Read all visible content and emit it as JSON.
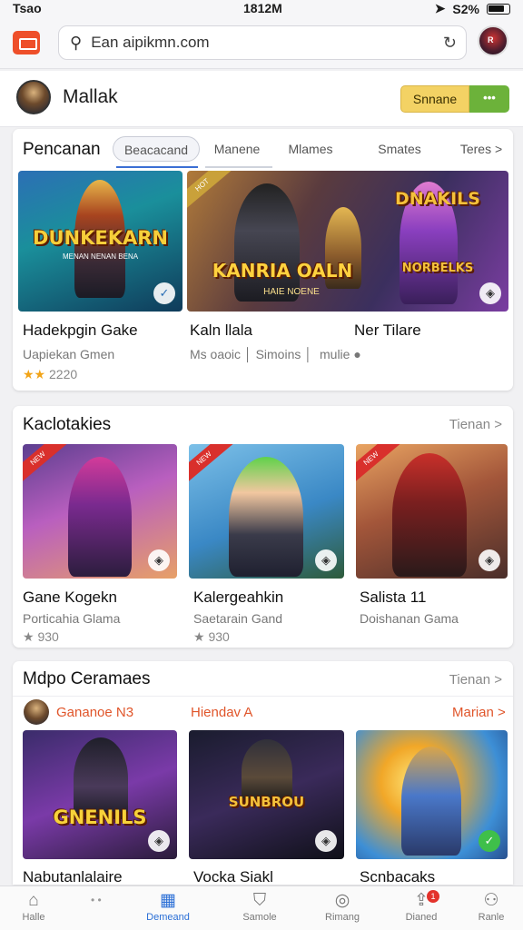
{
  "status": {
    "carrier": "Tsao",
    "time": "1812M",
    "battery": "S2%"
  },
  "browser": {
    "url": "Ean aipikmn.com",
    "avatar_text": "R"
  },
  "profile": {
    "name": "Mallak",
    "primary_button": "Snnane",
    "secondary_button": "•••"
  },
  "section1": {
    "title": "Pencanan",
    "tabs": [
      "Beacacand",
      "Manene",
      "Mlames",
      "Smates",
      "Teres >"
    ],
    "items": [
      {
        "banner": "DUNKEKARN",
        "banner_sub": "MENAN NENAN BENA",
        "title": "Hadekpgin Gake",
        "sub": "Uapiekan Gmen",
        "rating": "2220"
      },
      {
        "banner": "KANRIA OALN",
        "banner_sub": "HAIE NOENE",
        "title": "Kaln llala",
        "sub": "Ms oaoic",
        "sub2": "Simoins"
      },
      {
        "banner": "DNAKILS",
        "banner_sub": "NORBELKS",
        "title": "Ner Tilare",
        "sub": "mulie"
      }
    ]
  },
  "section2": {
    "title": "Kaclotakies",
    "more": "Tienan >",
    "items": [
      {
        "title": "Gane Kogekn",
        "sub": "Porticahia Glama",
        "rating": "930"
      },
      {
        "title": "Kalergeahkin",
        "sub": "Saetarain Gand",
        "rating": "930"
      },
      {
        "title": "Salista 11",
        "sub": "Doishanan Gama"
      }
    ]
  },
  "section3": {
    "title": "Mdpo Ceramaes",
    "more": "Tienan >",
    "headers": [
      "Gananoe N3",
      "Hiendav A",
      "Marian >"
    ],
    "items": [
      {
        "logo": "GNENILS",
        "title": "Nabutanlalaire"
      },
      {
        "logo": "SUNBROU",
        "title": "Vocka Siakl"
      },
      {
        "title": "Scnbacaks"
      }
    ]
  },
  "nav": [
    {
      "label": "Halle",
      "icon": "home-icon"
    },
    {
      "label": "Demeand",
      "icon": "grid-icon",
      "active": true
    },
    {
      "label": "Samole",
      "icon": "bag-icon"
    },
    {
      "label": "Rimang",
      "icon": "compass-icon"
    },
    {
      "label": "Dianed",
      "icon": "share-icon",
      "badge": "1"
    },
    {
      "label": "Ranle",
      "icon": "person-icon"
    }
  ]
}
